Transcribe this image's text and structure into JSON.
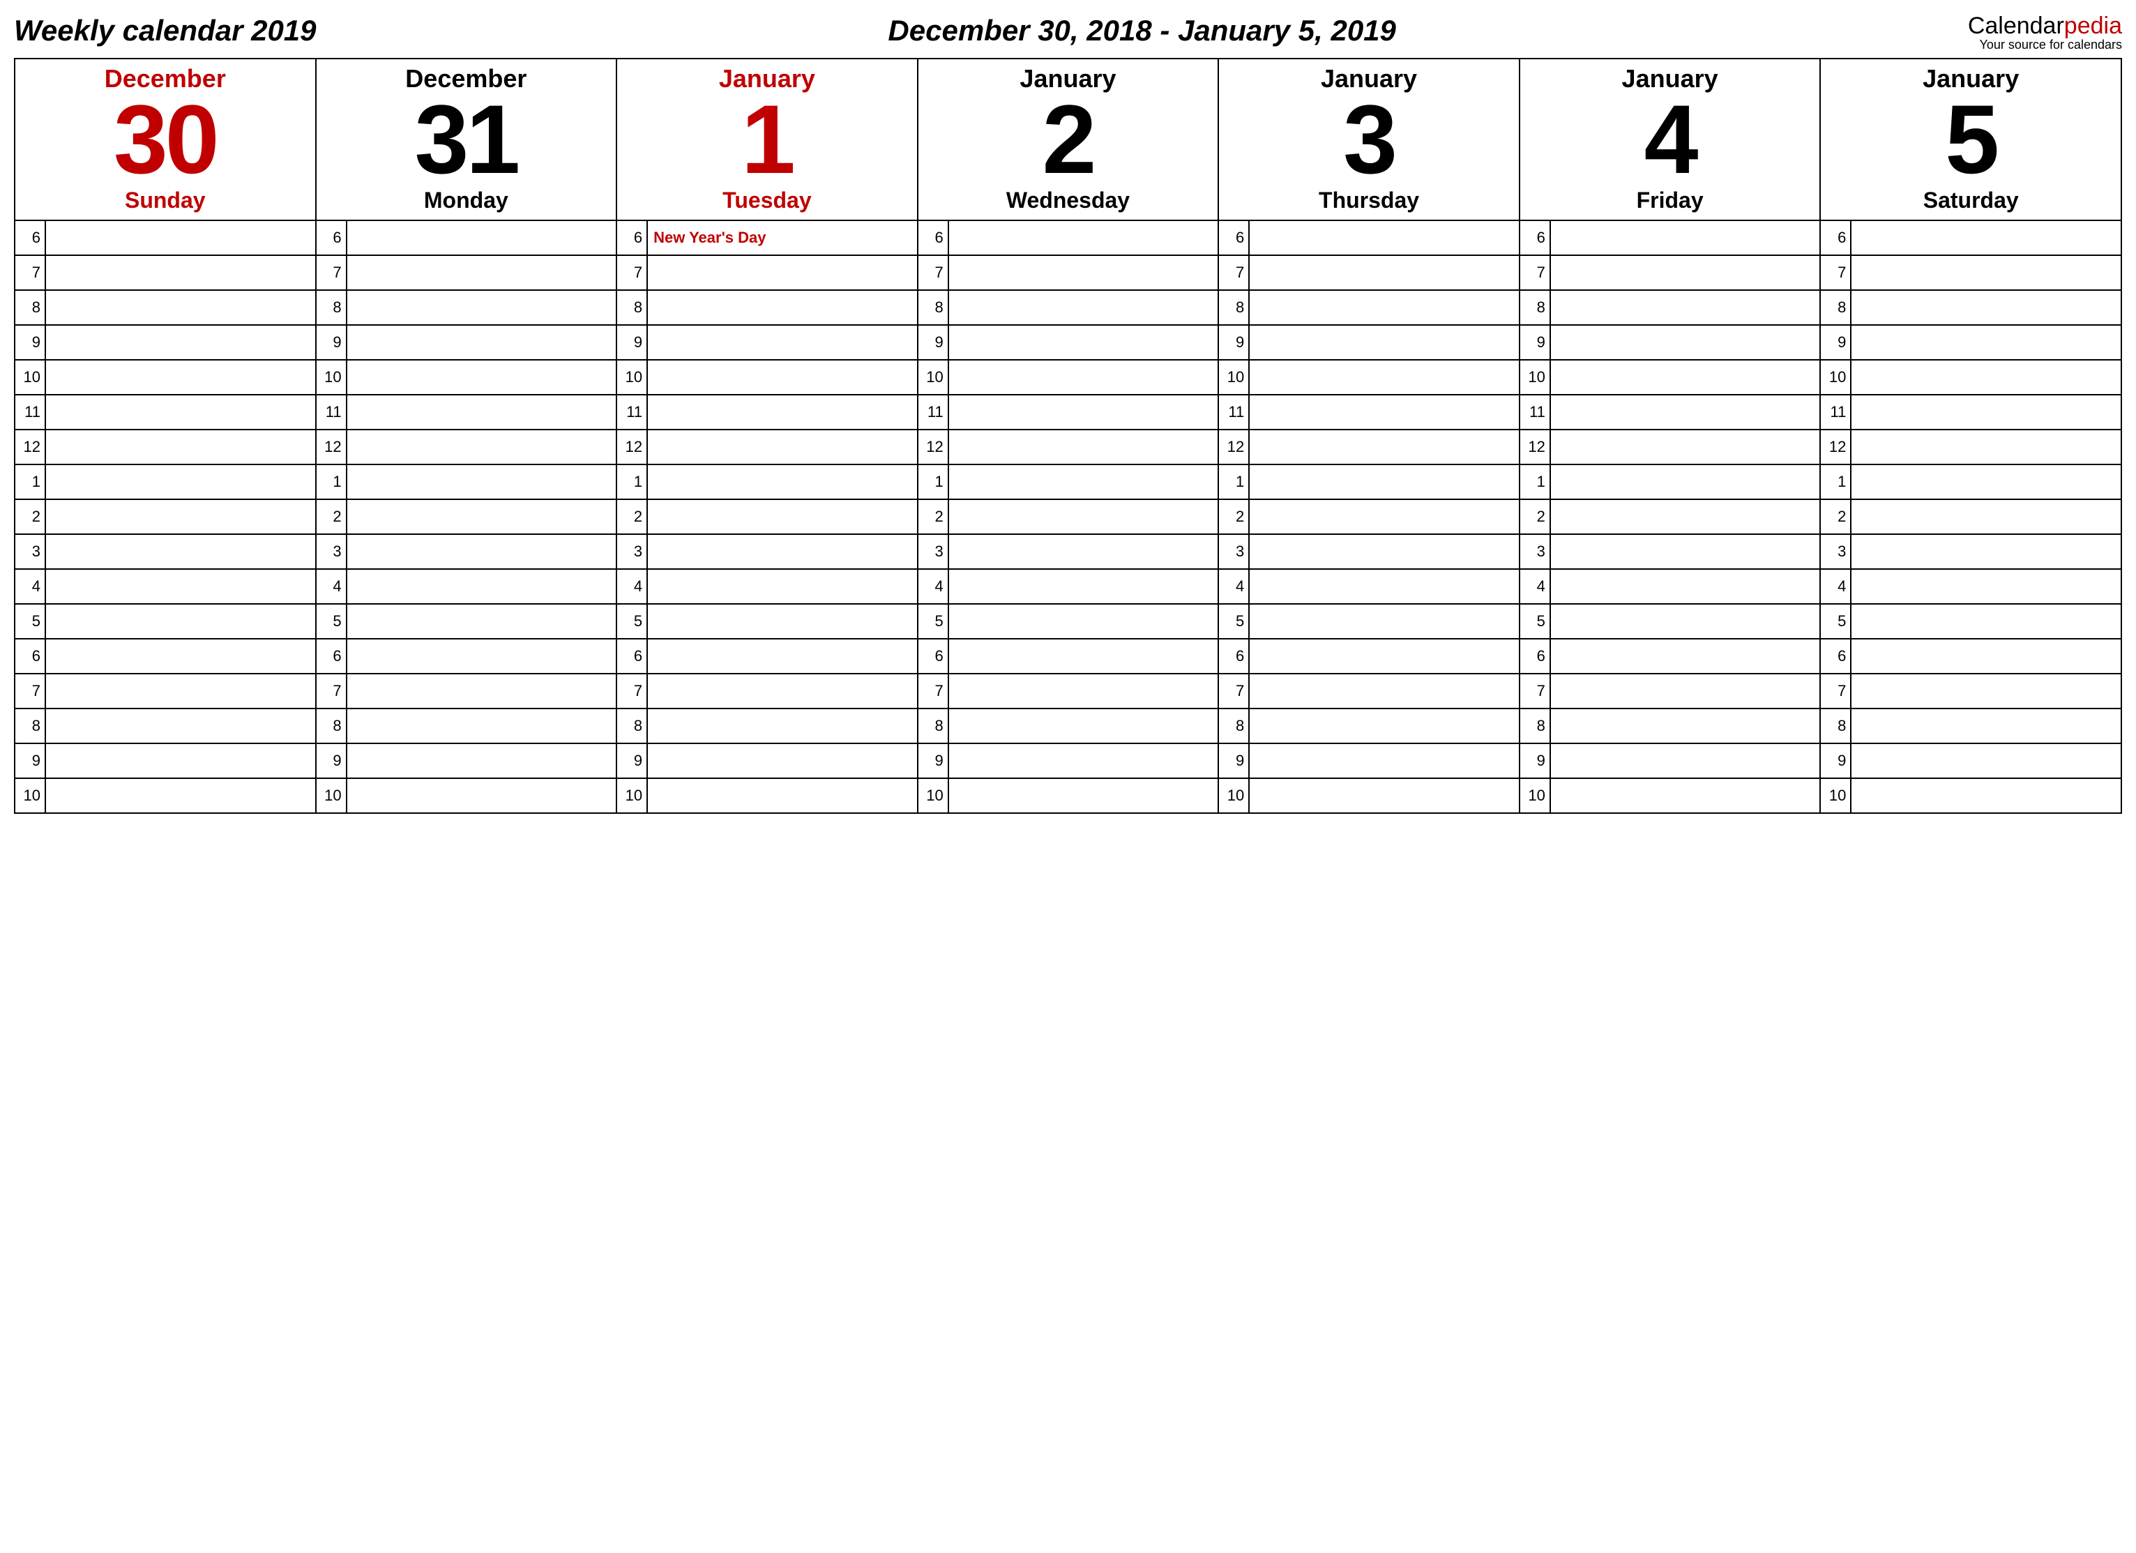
{
  "header": {
    "title_left": "Weekly calendar 2019",
    "title_center": "December 30, 2018 - January 5, 2019",
    "brand_part1": "Calendar",
    "brand_part2": "pedia",
    "tagline": "Your source for calendars"
  },
  "hours": [
    "6",
    "7",
    "8",
    "9",
    "10",
    "11",
    "12",
    "1",
    "2",
    "3",
    "4",
    "5",
    "6",
    "7",
    "8",
    "9",
    "10"
  ],
  "days": [
    {
      "month": "December",
      "daynum": "30",
      "weekday": "Sunday",
      "highlight": true,
      "events": {}
    },
    {
      "month": "December",
      "daynum": "31",
      "weekday": "Monday",
      "highlight": false,
      "events": {}
    },
    {
      "month": "January",
      "daynum": "1",
      "weekday": "Tuesday",
      "highlight": true,
      "events": {
        "0": "New Year's Day"
      }
    },
    {
      "month": "January",
      "daynum": "2",
      "weekday": "Wednesday",
      "highlight": false,
      "events": {}
    },
    {
      "month": "January",
      "daynum": "3",
      "weekday": "Thursday",
      "highlight": false,
      "events": {}
    },
    {
      "month": "January",
      "daynum": "4",
      "weekday": "Friday",
      "highlight": false,
      "events": {}
    },
    {
      "month": "January",
      "daynum": "5",
      "weekday": "Saturday",
      "highlight": false,
      "events": {}
    }
  ]
}
